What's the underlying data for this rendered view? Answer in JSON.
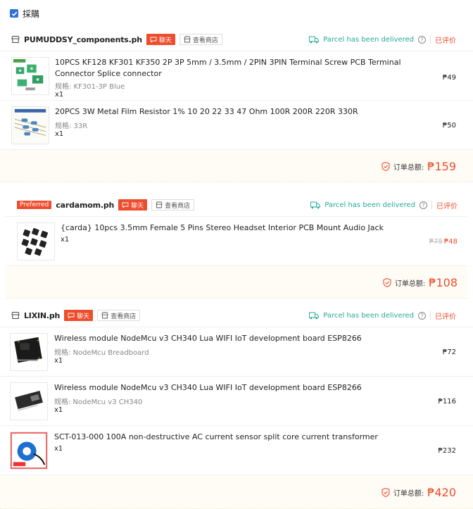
{
  "header": {
    "select_all_label": "採購"
  },
  "common": {
    "chat_label": "聊天",
    "store_label": "查看商店",
    "delivered_text": "Parcel has been delivered",
    "help_glyph": "?",
    "rated_label": "已评价",
    "total_label": "订单总额:",
    "qty_prefix": "x",
    "variant_prefix": "规格:",
    "colors": {
      "accent": "#ee4d2d",
      "delivered": "#26aa99",
      "checkbox": "#2f72d8"
    }
  },
  "orders": [
    {
      "shop": "PUMUDDSY_components.ph",
      "items": [
        {
          "title": "10PCS KF128 KF301 KF350 2P 3P 5mm / 3.5mm / 2PIN 3PIN Terminal Screw PCB Terminal Connector Splice connector",
          "variant": "规格: KF301-3P Blue",
          "qty": "x1",
          "price": "₱49"
        },
        {
          "title": "20PCS 3W Metal Film Resistor 1% 10 20 22 33 47 Ohm 100R 200R 220R 330R",
          "variant": "规格: 33R",
          "qty": "x1",
          "price": "₱50"
        }
      ],
      "total": "₱159"
    },
    {
      "shop": "cardamom.ph",
      "badge": "Preferred",
      "items": [
        {
          "title": "{carda} 10pcs 3.5mm Female 5 Pins Stereo Headset Interior PCB Mount Audio Jack",
          "qty": "x1",
          "price_old": "₱75",
          "price": "₱48"
        }
      ],
      "total": "₱108"
    },
    {
      "shop": "LIXIN.ph",
      "items": [
        {
          "title": "Wireless module NodeMcu v3 CH340 Lua WIFI IoT development board ESP8266",
          "variant": "规格: NodeMcu Breadboard",
          "qty": "x1",
          "price": "₱72"
        },
        {
          "title": "Wireless module NodeMcu v3 CH340 Lua WIFI IoT development board ESP8266",
          "variant": "规格: NodeMcu v3 CH340",
          "qty": "x1",
          "price": "₱116"
        },
        {
          "title": "SCT-013-000 100A non-destructive AC current sensor split core current transformer",
          "qty": "x1",
          "price": "₱232"
        }
      ],
      "total": "₱420"
    }
  ]
}
